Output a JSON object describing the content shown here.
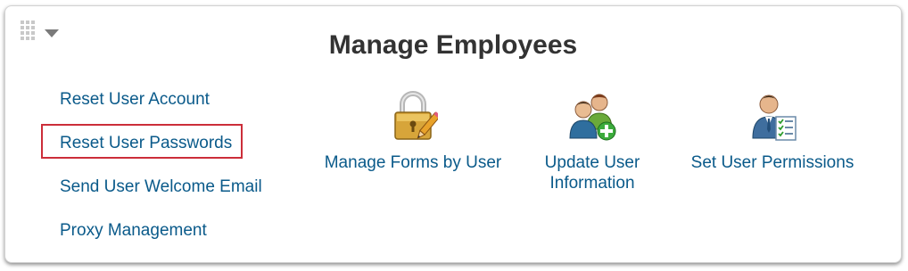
{
  "panel": {
    "title": "Manage Employees",
    "icons": {
      "drag": "drag-handle-icon",
      "menu": "chevron-down-icon"
    }
  },
  "links": [
    {
      "label": "Reset User Account"
    },
    {
      "label": "Reset User Passwords",
      "highlighted": true
    },
    {
      "label": "Send User Welcome Email"
    },
    {
      "label": "Proxy Management"
    }
  ],
  "tiles": [
    {
      "label": "Manage Forms by User",
      "icon": "padlock-pencil-icon"
    },
    {
      "label": "Update User Information",
      "icon": "users-add-icon"
    },
    {
      "label": "Set User Permissions",
      "icon": "user-checklist-icon"
    }
  ],
  "colors": {
    "link": "#0a5a8a",
    "title": "#333333",
    "highlight_border": "#cc2e3a"
  }
}
